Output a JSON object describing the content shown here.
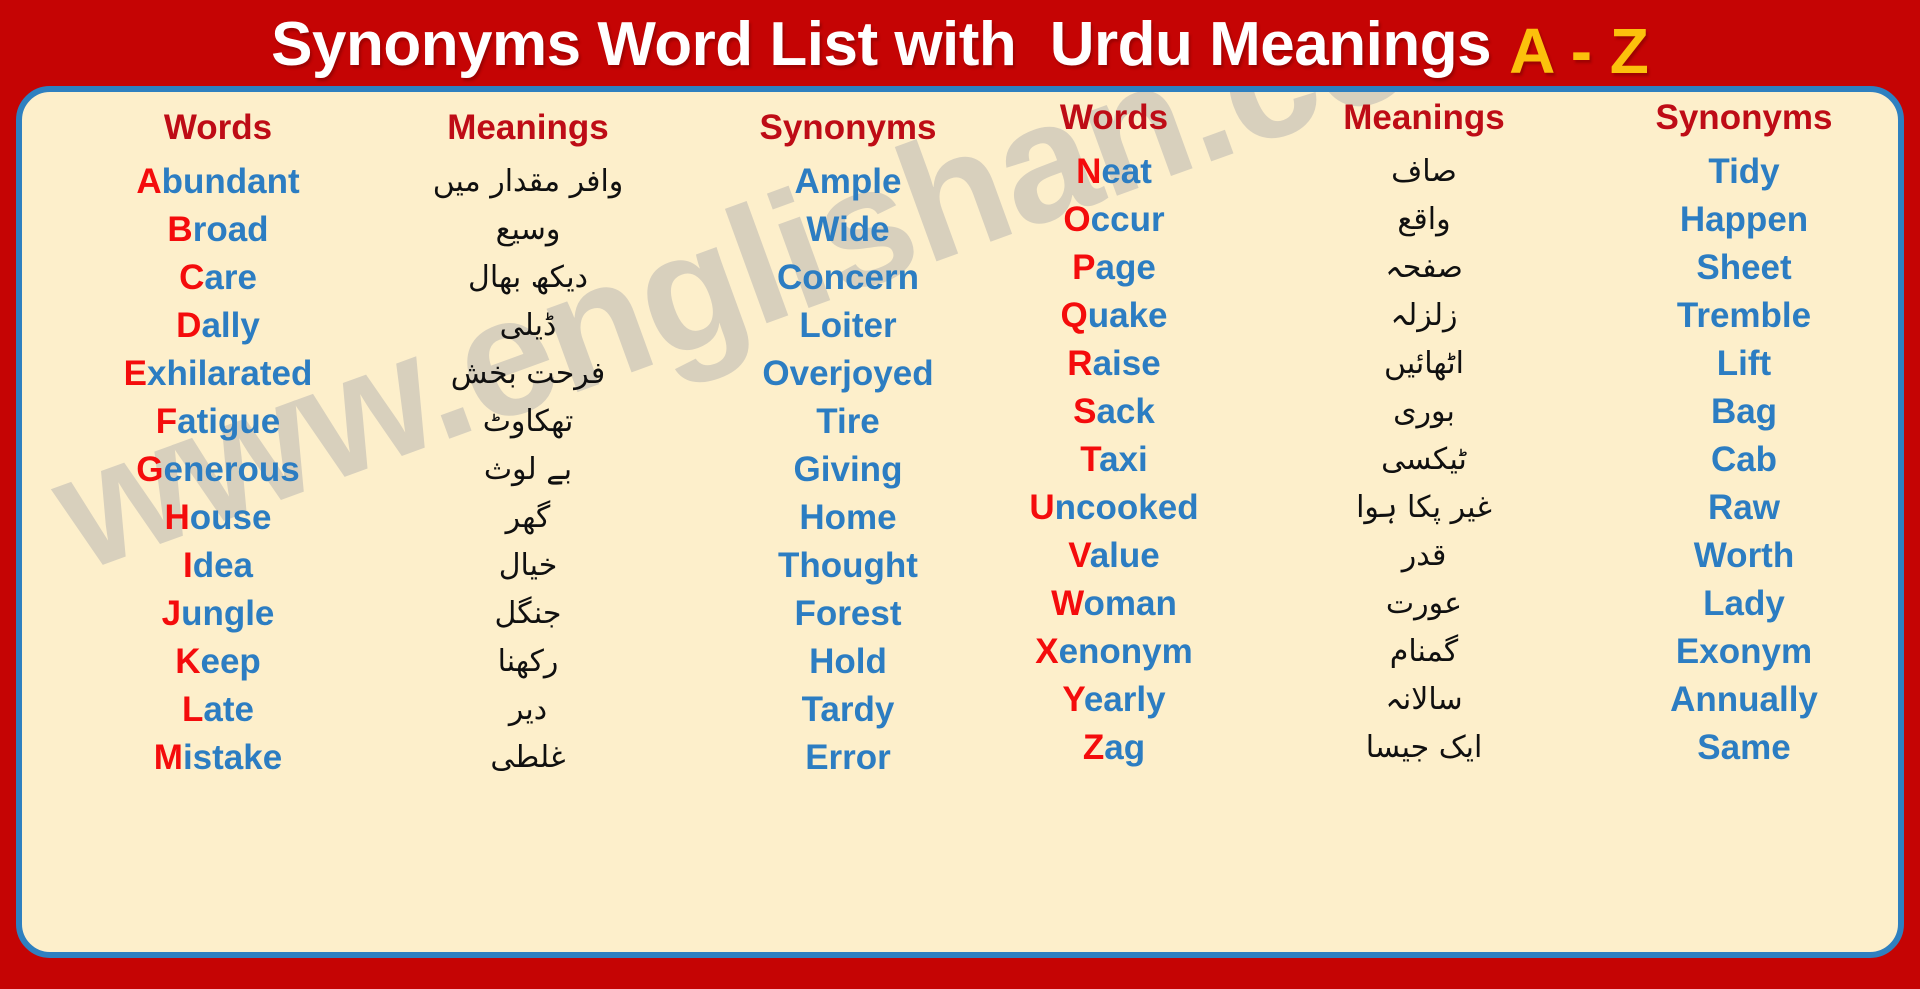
{
  "poster": {
    "title_main": "Synonyms Word List with  Urdu Meanings",
    "title_range": "A - Z",
    "watermark": "www.englishan.com",
    "colors": {
      "background_red": "#C50404",
      "panel_cream": "#FDEFCB",
      "panel_border_blue": "#2E80C0",
      "header_dark_red": "#BE0C16",
      "word_blue": "#2C7DC2",
      "initial_red": "#F40C0C",
      "title_gold": "#FCC10C",
      "watermark_grey": "#D8D0BD",
      "urdu_black": "#101010"
    }
  },
  "columns": {
    "words": "Words",
    "meanings": "Meanings",
    "synonyms": "Synonyms"
  },
  "left_table": [
    {
      "initial": "A",
      "rest": "bundant",
      "word": "Abundant",
      "urdu": "وافر مقدار میں",
      "synonym": "Ample"
    },
    {
      "initial": "B",
      "rest": "road",
      "word": "Broad",
      "urdu": "وسیع",
      "synonym": "Wide"
    },
    {
      "initial": "C",
      "rest": "are",
      "word": "Care",
      "urdu": "دیکھ بھال",
      "synonym": "Concern"
    },
    {
      "initial": "D",
      "rest": "ally",
      "word": "Dally",
      "urdu": "ڈیلی",
      "synonym": "Loiter"
    },
    {
      "initial": "E",
      "rest": "xhilarated",
      "word": "Exhilarated",
      "urdu": "فرحت بخش",
      "synonym": "Overjoyed"
    },
    {
      "initial": "F",
      "rest": "atigue",
      "word": "Fatigue",
      "urdu": "تھکاوٹ",
      "synonym": "Tire"
    },
    {
      "initial": "G",
      "rest": "enerous",
      "word": "Generous",
      "urdu": "بے لوث",
      "synonym": "Giving"
    },
    {
      "initial": "H",
      "rest": "ouse",
      "word": "House",
      "urdu": "گھر",
      "synonym": "Home"
    },
    {
      "initial": "I",
      "rest": "dea",
      "word": "Idea",
      "urdu": "خیال",
      "synonym": "Thought"
    },
    {
      "initial": "J",
      "rest": "ungle",
      "word": "Jungle",
      "urdu": "جنگل",
      "synonym": "Forest"
    },
    {
      "initial": "K",
      "rest": "eep",
      "word": "Keep",
      "urdu": "رکھنا",
      "synonym": "Hold"
    },
    {
      "initial": "L",
      "rest": "ate",
      "word": "Late",
      "urdu": "دیر",
      "synonym": "Tardy"
    },
    {
      "initial": "M",
      "rest": "istake",
      "word": "Mistake",
      "urdu": "غلطی",
      "synonym": "Error"
    }
  ],
  "right_table": [
    {
      "initial": "N",
      "rest": "eat",
      "word": "Neat",
      "urdu": "صاف",
      "synonym": "Tidy"
    },
    {
      "initial": "O",
      "rest": "ccur",
      "word": "Occur",
      "urdu": "واقع",
      "synonym": "Happen"
    },
    {
      "initial": "P",
      "rest": "age",
      "word": "Page",
      "urdu": "صفحہ",
      "synonym": "Sheet"
    },
    {
      "initial": "Q",
      "rest": "uake",
      "word": "Quake",
      "urdu": "زلزلہ",
      "synonym": "Tremble"
    },
    {
      "initial": "R",
      "rest": "aise",
      "word": "Raise",
      "urdu": "اٹھائیں",
      "synonym": "Lift"
    },
    {
      "initial": "S",
      "rest": "ack",
      "word": "Sack",
      "urdu": "بوری",
      "synonym": "Bag"
    },
    {
      "initial": "T",
      "rest": "axi",
      "word": "Taxi",
      "urdu": "ٹیکسی",
      "synonym": "Cab"
    },
    {
      "initial": "U",
      "rest": "ncooked",
      "word": "Uncooked",
      "urdu": "غیر پکا ہوا",
      "synonym": "Raw"
    },
    {
      "initial": "V",
      "rest": "alue",
      "word": "Value",
      "urdu": "قدر",
      "synonym": "Worth"
    },
    {
      "initial": "W",
      "rest": "oman",
      "word": "Woman",
      "urdu": "عورت",
      "synonym": "Lady"
    },
    {
      "initial": "X",
      "rest": "enonym",
      "word": "Xenonym",
      "urdu": "گمنام",
      "synonym": "Exonym"
    },
    {
      "initial": "Y",
      "rest": "early",
      "word": "Yearly",
      "urdu": "سالانہ",
      "synonym": "Annually"
    },
    {
      "initial": "Z",
      "rest": "ag",
      "word": "Zag",
      "urdu": "ایک جیسا",
      "synonym": "Same"
    }
  ]
}
